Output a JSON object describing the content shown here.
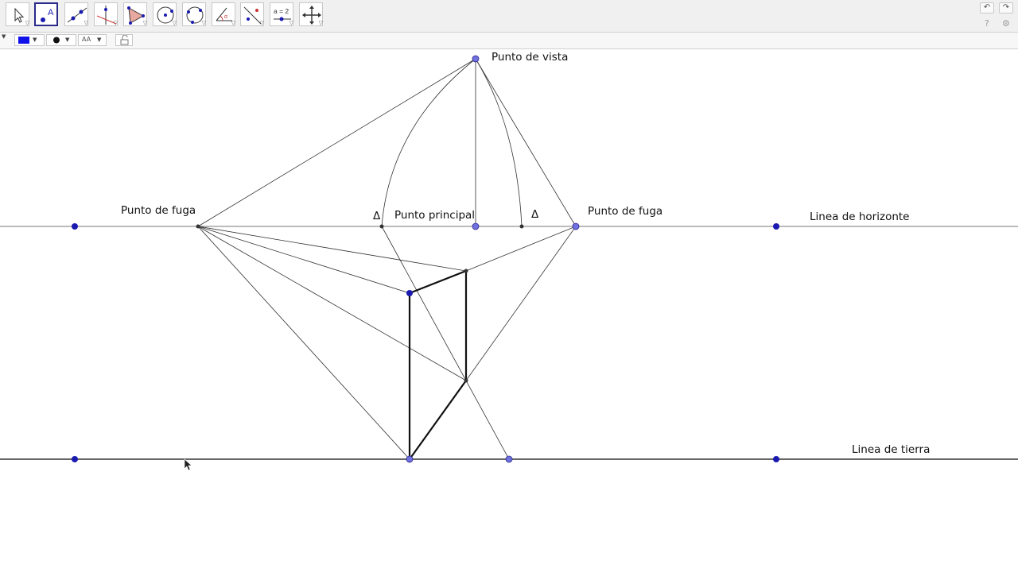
{
  "toolbar": {
    "tools": [
      {
        "name": "move-tool-button",
        "icon": "cursor-arrow-icon"
      },
      {
        "name": "point-tool-button",
        "icon": "point-icon",
        "label": "A",
        "selected": true
      },
      {
        "name": "line-tool-button",
        "icon": "line-through-points-icon"
      },
      {
        "name": "perpendicular-tool-button",
        "icon": "perpendicular-line-icon"
      },
      {
        "name": "polygon-tool-button",
        "icon": "polygon-icon"
      },
      {
        "name": "circle-tool-button",
        "icon": "circle-center-point-icon"
      },
      {
        "name": "circle-three-points-button",
        "icon": "circle-three-points-icon"
      },
      {
        "name": "angle-tool-button",
        "icon": "angle-icon"
      },
      {
        "name": "reflect-tool-button",
        "icon": "reflect-about-line-icon"
      },
      {
        "name": "slider-tool-button",
        "icon": "slider-icon",
        "label": "a = 2"
      },
      {
        "name": "move-view-button",
        "icon": "move-graphics-view-icon"
      }
    ],
    "undo_icon": "↶",
    "redo_icon": "↷",
    "help_icon": "?",
    "settings_icon": "⚙"
  },
  "stylebar": {
    "color": "#1010e8",
    "point_style_icon": "point-style-icon",
    "label_style_text": "AA",
    "lock_icon": "lock-icon"
  },
  "labels": {
    "punto_de_vista": "Punto de vista",
    "punto_de_fuga_left": "Punto de fuga",
    "punto_principal": "Punto principal",
    "punto_de_fuga_right": "Punto de fuga",
    "linea_horizonte": "Linea de horizonte",
    "linea_tierra": "Linea de tierra",
    "delta_left": "Δ",
    "delta_right": "Δ"
  },
  "colors": {
    "point_dark": "#1a1ab0",
    "point_light": "#7070e0",
    "line": "#333333",
    "bold_line": "#111111"
  }
}
